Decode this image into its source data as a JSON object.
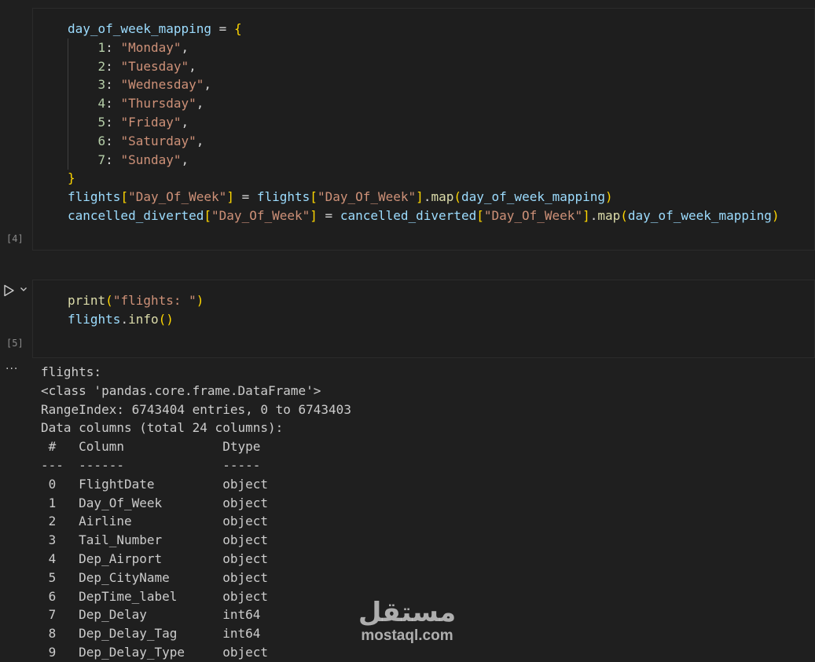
{
  "cells": [
    {
      "execution_count": "[4]",
      "lines": [
        [
          [
            "v",
            "day_of_week_mapping"
          ],
          [
            "p",
            " = "
          ],
          [
            "b1",
            "{"
          ]
        ],
        [
          [
            "p",
            "    "
          ],
          [
            "n",
            "1"
          ],
          [
            "p",
            ": "
          ],
          [
            "s",
            "\"Monday\""
          ],
          [
            "p",
            ","
          ]
        ],
        [
          [
            "p",
            "    "
          ],
          [
            "n",
            "2"
          ],
          [
            "p",
            ": "
          ],
          [
            "s",
            "\"Tuesday\""
          ],
          [
            "p",
            ","
          ]
        ],
        [
          [
            "p",
            "    "
          ],
          [
            "n",
            "3"
          ],
          [
            "p",
            ": "
          ],
          [
            "s",
            "\"Wednesday\""
          ],
          [
            "p",
            ","
          ]
        ],
        [
          [
            "p",
            "    "
          ],
          [
            "n",
            "4"
          ],
          [
            "p",
            ": "
          ],
          [
            "s",
            "\"Thursday\""
          ],
          [
            "p",
            ","
          ]
        ],
        [
          [
            "p",
            "    "
          ],
          [
            "n",
            "5"
          ],
          [
            "p",
            ": "
          ],
          [
            "s",
            "\"Friday\""
          ],
          [
            "p",
            ","
          ]
        ],
        [
          [
            "p",
            "    "
          ],
          [
            "n",
            "6"
          ],
          [
            "p",
            ": "
          ],
          [
            "s",
            "\"Saturday\""
          ],
          [
            "p",
            ","
          ]
        ],
        [
          [
            "p",
            "    "
          ],
          [
            "n",
            "7"
          ],
          [
            "p",
            ": "
          ],
          [
            "s",
            "\"Sunday\""
          ],
          [
            "p",
            ","
          ]
        ],
        [
          [
            "b1",
            "}"
          ]
        ],
        [
          [
            "v",
            "flights"
          ],
          [
            "b1",
            "["
          ],
          [
            "s",
            "\"Day_Of_Week\""
          ],
          [
            "b1",
            "]"
          ],
          [
            "p",
            " = "
          ],
          [
            "v",
            "flights"
          ],
          [
            "b1",
            "["
          ],
          [
            "s",
            "\"Day_Of_Week\""
          ],
          [
            "b1",
            "]"
          ],
          [
            "p",
            "."
          ],
          [
            "f",
            "map"
          ],
          [
            "b1",
            "("
          ],
          [
            "v",
            "day_of_week_mapping"
          ],
          [
            "b1",
            ")"
          ]
        ],
        [
          [
            "v",
            "cancelled_diverted"
          ],
          [
            "b1",
            "["
          ],
          [
            "s",
            "\"Day_Of_Week\""
          ],
          [
            "b1",
            "]"
          ],
          [
            "p",
            " = "
          ],
          [
            "v",
            "cancelled_diverted"
          ],
          [
            "b1",
            "["
          ],
          [
            "s",
            "\"Day_Of_Week\""
          ],
          [
            "b1",
            "]"
          ],
          [
            "p",
            "."
          ],
          [
            "f",
            "map"
          ],
          [
            "b1",
            "("
          ],
          [
            "v",
            "day_of_week_mapping"
          ],
          [
            "b1",
            ")"
          ]
        ]
      ]
    },
    {
      "execution_count": "[5]",
      "lines": [
        [
          [
            "f",
            "print"
          ],
          [
            "b1",
            "("
          ],
          [
            "s",
            "\"flights: \""
          ],
          [
            "b1",
            ")"
          ]
        ],
        [
          [
            "v",
            "flights"
          ],
          [
            "p",
            "."
          ],
          [
            "f",
            "info"
          ],
          [
            "b1",
            "("
          ],
          [
            "b1",
            ")"
          ]
        ]
      ]
    }
  ],
  "output_lines": [
    "flights:",
    "<class 'pandas.core.frame.DataFrame'>",
    "RangeIndex: 6743404 entries, 0 to 6743403",
    "Data columns (total 24 columns):",
    " #   Column             Dtype ",
    "---  ------             ----- ",
    " 0   FlightDate         object",
    " 1   Day_Of_Week        object",
    " 2   Airline            object",
    " 3   Tail_Number        object",
    " 4   Dep_Airport        object",
    " 5   Dep_CityName       object",
    " 6   DepTime_label      object",
    " 7   Dep_Delay          int64 ",
    " 8   Dep_Delay_Tag      int64 ",
    " 9   Dep_Delay_Type     object"
  ],
  "controls": {
    "run_icon": "play-icon",
    "expand_icon": "chevron-down-icon",
    "more_label": "···"
  },
  "watermark": {
    "logo": "مستقل",
    "url": "mostaql.com"
  },
  "colors": {
    "background": "#1f1f1f",
    "variable": "#9cdcfe",
    "string": "#ce9178",
    "number": "#b5cea8",
    "function": "#dcdcaa",
    "bracket_level1": "#ffd700"
  }
}
